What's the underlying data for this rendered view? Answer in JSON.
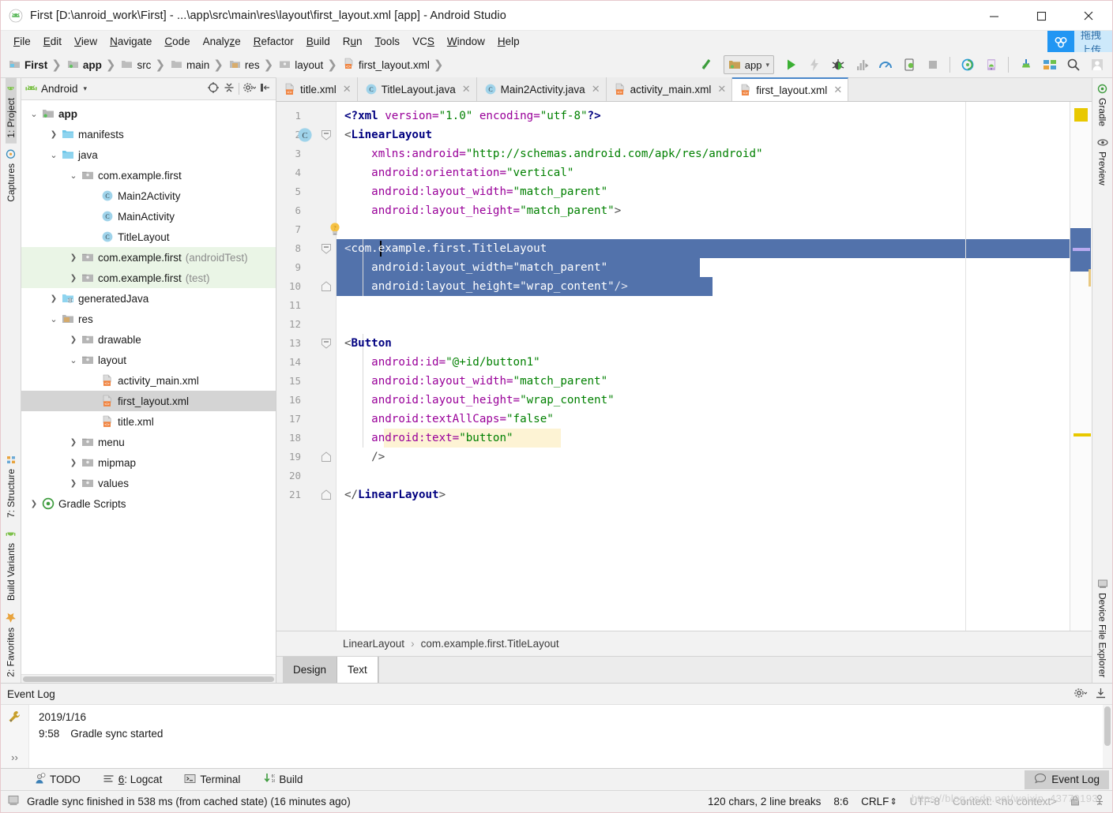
{
  "window": {
    "title": "First [D:\\anroid_work\\First] - ...\\app\\src\\main\\res\\layout\\first_layout.xml [app] - Android Studio",
    "minimize": "—",
    "maximize": "☐",
    "close": "✕"
  },
  "menubar": {
    "items": [
      "File",
      "Edit",
      "View",
      "Navigate",
      "Code",
      "Analyze",
      "Refactor",
      "Build",
      "Run",
      "Tools",
      "VCS",
      "Window",
      "Help"
    ],
    "badge_text": "拖拽上传"
  },
  "breadcrumb": {
    "items": [
      "First",
      "app",
      "src",
      "main",
      "res",
      "layout",
      "first_layout.xml"
    ],
    "separator": "›"
  },
  "toolbar": {
    "run_config": "app",
    "run_config_caret": "▾",
    "icons": [
      "make-project-icon",
      "run-icon",
      "apply-changes-icon",
      "debug-icon",
      "run-profiler-icon",
      "profiler-icon",
      "attach-debugger-icon",
      "stop-icon",
      "sync-gradle-icon",
      "avd-manager-icon",
      "sdk-manager-icon",
      "project-structure-icon",
      "search-everywhere-icon",
      "user-account-icon"
    ]
  },
  "left_rail": {
    "top": [
      {
        "label": "1: Project",
        "icon": "android-icon",
        "active": true
      },
      {
        "label": "Captures",
        "icon": "captures-icon",
        "active": false
      }
    ],
    "bottom": [
      {
        "label": "7: Structure",
        "icon": "structure-icon"
      },
      {
        "label": "Build Variants",
        "icon": "build-variants-icon"
      },
      {
        "label": "2: Favorites",
        "icon": "star-icon"
      }
    ]
  },
  "right_rail": {
    "top": [
      {
        "label": "Gradle",
        "icon": "gradle-icon"
      },
      {
        "label": "Preview",
        "icon": "eye-icon"
      }
    ],
    "bottom": [
      {
        "label": "Device File Explorer",
        "icon": "device-icon"
      }
    ]
  },
  "project_panel": {
    "title": "Android",
    "caret": "▾",
    "header_icons": [
      "target-icon",
      "collapse-all-icon",
      "settings-gear-icon",
      "hide-icon"
    ],
    "tree": [
      {
        "depth": 0,
        "arrow": "⌄",
        "icon": "module-icon",
        "label": "app",
        "bold": true,
        "suffix": "",
        "state": "normal"
      },
      {
        "depth": 1,
        "arrow": "›",
        "icon": "folder-icon",
        "label": "manifests",
        "bold": false,
        "suffix": "",
        "state": "normal"
      },
      {
        "depth": 1,
        "arrow": "⌄",
        "icon": "folder-icon",
        "label": "java",
        "bold": false,
        "suffix": "",
        "state": "normal"
      },
      {
        "depth": 2,
        "arrow": "⌄",
        "icon": "package-icon",
        "label": "com.example.first",
        "bold": false,
        "suffix": "",
        "state": "normal"
      },
      {
        "depth": 3,
        "arrow": "",
        "icon": "class-icon",
        "label": "Main2Activity",
        "bold": false,
        "suffix": "",
        "state": "normal"
      },
      {
        "depth": 3,
        "arrow": "",
        "icon": "class-icon",
        "label": "MainActivity",
        "bold": false,
        "suffix": "",
        "state": "normal"
      },
      {
        "depth": 3,
        "arrow": "",
        "icon": "class-icon",
        "label": "TitleLayout",
        "bold": false,
        "suffix": "",
        "state": "normal"
      },
      {
        "depth": 2,
        "arrow": "›",
        "icon": "package-icon",
        "label": "com.example.first",
        "bold": false,
        "suffix": "(androidTest)",
        "state": "green"
      },
      {
        "depth": 2,
        "arrow": "›",
        "icon": "package-icon",
        "label": "com.example.first",
        "bold": false,
        "suffix": "(test)",
        "state": "green"
      },
      {
        "depth": 1,
        "arrow": "›",
        "icon": "generated-folder-icon",
        "label": "generatedJava",
        "bold": false,
        "suffix": "",
        "state": "normal"
      },
      {
        "depth": 1,
        "arrow": "⌄",
        "icon": "res-folder-icon",
        "label": "res",
        "bold": false,
        "suffix": "",
        "state": "normal"
      },
      {
        "depth": 2,
        "arrow": "›",
        "icon": "package-icon",
        "label": "drawable",
        "bold": false,
        "suffix": "",
        "state": "normal"
      },
      {
        "depth": 2,
        "arrow": "⌄",
        "icon": "package-icon",
        "label": "layout",
        "bold": false,
        "suffix": "",
        "state": "normal"
      },
      {
        "depth": 3,
        "arrow": "",
        "icon": "xml-file-icon",
        "label": "activity_main.xml",
        "bold": false,
        "suffix": "",
        "state": "normal"
      },
      {
        "depth": 3,
        "arrow": "",
        "icon": "xml-file-icon",
        "label": "first_layout.xml",
        "bold": false,
        "suffix": "",
        "state": "selected"
      },
      {
        "depth": 3,
        "arrow": "",
        "icon": "xml-file-icon",
        "label": "title.xml",
        "bold": false,
        "suffix": "",
        "state": "normal"
      },
      {
        "depth": 2,
        "arrow": "›",
        "icon": "package-icon",
        "label": "menu",
        "bold": false,
        "suffix": "",
        "state": "normal"
      },
      {
        "depth": 2,
        "arrow": "›",
        "icon": "package-icon",
        "label": "mipmap",
        "bold": false,
        "suffix": "",
        "state": "normal"
      },
      {
        "depth": 2,
        "arrow": "›",
        "icon": "package-icon",
        "label": "values",
        "bold": false,
        "suffix": "",
        "state": "normal"
      },
      {
        "depth": 0,
        "arrow": "›",
        "icon": "gradle-scripts-icon",
        "label": "Gradle Scripts",
        "bold": false,
        "suffix": "",
        "state": "normal"
      }
    ]
  },
  "editor_tabs": [
    {
      "label": "title.xml",
      "icon": "xml-file-icon",
      "active": false,
      "close": "✕"
    },
    {
      "label": "TitleLayout.java",
      "icon": "class-icon",
      "active": false,
      "close": "✕"
    },
    {
      "label": "Main2Activity.java",
      "icon": "class-icon",
      "active": false,
      "close": "✕"
    },
    {
      "label": "activity_main.xml",
      "icon": "xml-file-icon",
      "active": false,
      "close": "✕"
    },
    {
      "label": "first_layout.xml",
      "icon": "xml-file-icon",
      "active": true,
      "close": "✕"
    }
  ],
  "code": {
    "lines": [
      {
        "n": 1,
        "segments": [
          {
            "t": "pi",
            "s": "<?xml "
          },
          {
            "t": "attr",
            "s": "version="
          },
          {
            "t": "val",
            "s": "\"1.0\""
          },
          {
            "t": "punc",
            "s": " "
          },
          {
            "t": "attr",
            "s": "encoding="
          },
          {
            "t": "val",
            "s": "\"utf-8\""
          },
          {
            "t": "pi",
            "s": "?>"
          }
        ]
      },
      {
        "n": 2,
        "segments": [
          {
            "t": "punc",
            "s": "<"
          },
          {
            "t": "tag",
            "s": "LinearLayout"
          }
        ]
      },
      {
        "n": 3,
        "segments": [
          {
            "t": "punc",
            "s": "    "
          },
          {
            "t": "attr",
            "s": "xmlns:android="
          },
          {
            "t": "val",
            "s": "\"http://schemas.android.com/apk/res/android\""
          }
        ]
      },
      {
        "n": 4,
        "segments": [
          {
            "t": "punc",
            "s": "    "
          },
          {
            "t": "attr",
            "s": "android:orientation="
          },
          {
            "t": "val",
            "s": "\"vertical\""
          }
        ]
      },
      {
        "n": 5,
        "segments": [
          {
            "t": "punc",
            "s": "    "
          },
          {
            "t": "attr",
            "s": "android:layout_width="
          },
          {
            "t": "val",
            "s": "\"match_parent\""
          }
        ]
      },
      {
        "n": 6,
        "segments": [
          {
            "t": "punc",
            "s": "    "
          },
          {
            "t": "attr",
            "s": "android:layout_height="
          },
          {
            "t": "val",
            "s": "\"match_parent\""
          },
          {
            "t": "punc",
            "s": ">"
          }
        ]
      },
      {
        "n": 7,
        "segments": []
      },
      {
        "n": 8,
        "segments": [
          {
            "t": "sel-punc",
            "s": "<"
          },
          {
            "t": "sel",
            "s": "com.example.first.TitleLayout"
          }
        ]
      },
      {
        "n": 9,
        "segments": [
          {
            "t": "sel",
            "s": "    android:layout_width=\"match_parent\""
          }
        ]
      },
      {
        "n": 10,
        "segments": [
          {
            "t": "sel",
            "s": "    android:layout_height=\"wrap_content\""
          },
          {
            "t": "sel-punc",
            "s": "/>"
          }
        ]
      },
      {
        "n": 11,
        "segments": []
      },
      {
        "n": 12,
        "segments": []
      },
      {
        "n": 13,
        "segments": [
          {
            "t": "punc",
            "s": "<"
          },
          {
            "t": "tag",
            "s": "Button"
          }
        ]
      },
      {
        "n": 14,
        "segments": [
          {
            "t": "punc",
            "s": "    "
          },
          {
            "t": "attr",
            "s": "android:id="
          },
          {
            "t": "val",
            "s": "\"@+id/button1\""
          }
        ]
      },
      {
        "n": 15,
        "segments": [
          {
            "t": "punc",
            "s": "    "
          },
          {
            "t": "attr",
            "s": "android:layout_width="
          },
          {
            "t": "val",
            "s": "\"match_parent\""
          }
        ]
      },
      {
        "n": 16,
        "segments": [
          {
            "t": "punc",
            "s": "    "
          },
          {
            "t": "attr",
            "s": "android:layout_height="
          },
          {
            "t": "val",
            "s": "\"wrap_content\""
          }
        ]
      },
      {
        "n": 17,
        "segments": [
          {
            "t": "punc",
            "s": "    "
          },
          {
            "t": "attr",
            "s": "android:textAllCaps="
          },
          {
            "t": "val",
            "s": "\"false\""
          }
        ]
      },
      {
        "n": 18,
        "segments": [
          {
            "t": "punc",
            "s": "    "
          },
          {
            "t": "attr",
            "s": "android:text="
          },
          {
            "t": "val",
            "s": "\"button\""
          }
        ]
      },
      {
        "n": 19,
        "segments": [
          {
            "t": "punc",
            "s": "    />"
          }
        ]
      },
      {
        "n": 20,
        "segments": []
      },
      {
        "n": 21,
        "segments": [
          {
            "t": "punc",
            "s": "</"
          },
          {
            "t": "tag",
            "s": "LinearLayout"
          },
          {
            "t": "punc",
            "s": ">"
          }
        ]
      }
    ],
    "gutter_markers": {
      "class_marker_line": 2,
      "class_marker_glyph": "C",
      "bulb_line": 7,
      "fold_lines": [
        2,
        8,
        10,
        13,
        19,
        21
      ]
    },
    "selection_lines": [
      8,
      9,
      10
    ],
    "highlight_line": 18,
    "colors": {
      "selection": "#5272ab",
      "tag": "#000080",
      "attribute": "#990099",
      "value": "#008000",
      "current_line": "#fdf6e3",
      "search_highlight": "#fdf3d4"
    }
  },
  "editor_breadcrumbs": {
    "items": [
      "LinearLayout",
      "com.example.first.TitleLayout"
    ],
    "separator": "›"
  },
  "design_text_tabs": [
    {
      "label": "Design",
      "active": false
    },
    {
      "label": "Text",
      "active": true
    }
  ],
  "event_log": {
    "title": "Event Log",
    "date": "2019/1/16",
    "time": "9:58",
    "message": "Gradle sync started",
    "expand_glyph": "››",
    "header_icons": [
      "settings-gear-icon",
      "export-icon"
    ]
  },
  "bottom_tabs": [
    {
      "label": "TODO",
      "icon": "todo-icon",
      "mnemonic": ""
    },
    {
      "label": "6: Logcat",
      "icon": "logcat-icon",
      "mnemonic": "6"
    },
    {
      "label": "Terminal",
      "icon": "terminal-icon",
      "mnemonic": ""
    },
    {
      "label": "Build",
      "icon": "build-icon",
      "mnemonic": ""
    }
  ],
  "bottom_right": {
    "event_log_label": "Event Log",
    "event_log_icon": "speech-bubble-icon"
  },
  "statusbar": {
    "message": "Gradle sync finished in 538 ms (from cached state) (16 minutes ago)",
    "chars": "120 chars, 2 line breaks",
    "caret_position": "8:6",
    "line_separator": "CRLF",
    "line_separator_caret": "⇕",
    "encoding": "UTF-8",
    "context": "Context: <no context>",
    "watermark": "https://blog.csdn.net/weixin_43779193",
    "icons": [
      "memory-icon",
      "lock-icon",
      "hector-icon"
    ]
  }
}
